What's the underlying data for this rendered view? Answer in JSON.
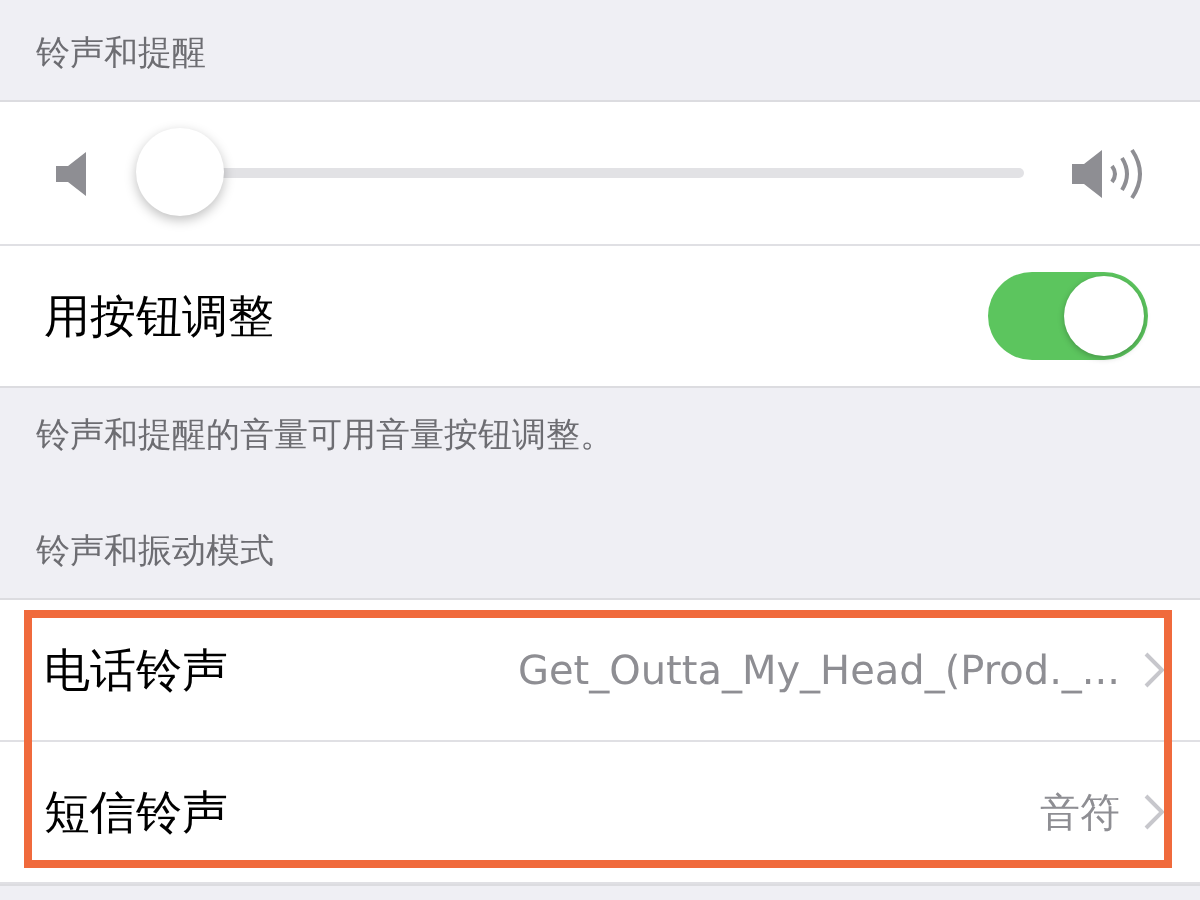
{
  "ringer_section": {
    "header": "铃声和提醒",
    "volume_slider": {
      "level": 0.04
    },
    "change_with_buttons": {
      "label": "用按钮调整",
      "on": true
    },
    "footer": "铃声和提醒的音量可用音量按钮调整。"
  },
  "sounds_section": {
    "header": "铃声和振动模式",
    "highlighted": true,
    "items": [
      {
        "label": "电话铃声",
        "value": "Get_Outta_My_Head_(Prod._..."
      },
      {
        "label": "短信铃声",
        "value": "音符"
      }
    ]
  }
}
